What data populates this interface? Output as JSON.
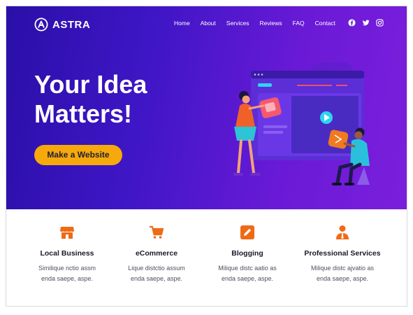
{
  "brand": {
    "name": "ASTRA"
  },
  "nav": {
    "items": [
      "Home",
      "About",
      "Services",
      "Reviews",
      "FAQ",
      "Contact"
    ]
  },
  "social": [
    "facebook-icon",
    "twitter-icon",
    "instagram-icon"
  ],
  "hero": {
    "headline_line1": "Your Idea",
    "headline_line2": "Matters!",
    "cta_label": "Make a Website"
  },
  "features": [
    {
      "icon": "store-icon",
      "title": "Local Business",
      "desc_line1": "Similique nctio assm",
      "desc_line2": "enda saepe, aspe."
    },
    {
      "icon": "cart-icon",
      "title": "eCommerce",
      "desc_line1": "Lique distctio assum",
      "desc_line2": "enda saepe, aspe."
    },
    {
      "icon": "edit-icon",
      "title": "Blogging",
      "desc_line1": "Milique distc aatio as",
      "desc_line2": "enda saepe, aspe."
    },
    {
      "icon": "professional-icon",
      "title": "Professional Services",
      "desc_line1": "Milique distc ajvatio as",
      "desc_line2": "enda saepe, aspe."
    }
  ],
  "colors": {
    "accent": "#f7a90c",
    "icon_orange": "#ef6a16",
    "hero_start": "#2a0fa8",
    "hero_end": "#7b1fdc"
  }
}
